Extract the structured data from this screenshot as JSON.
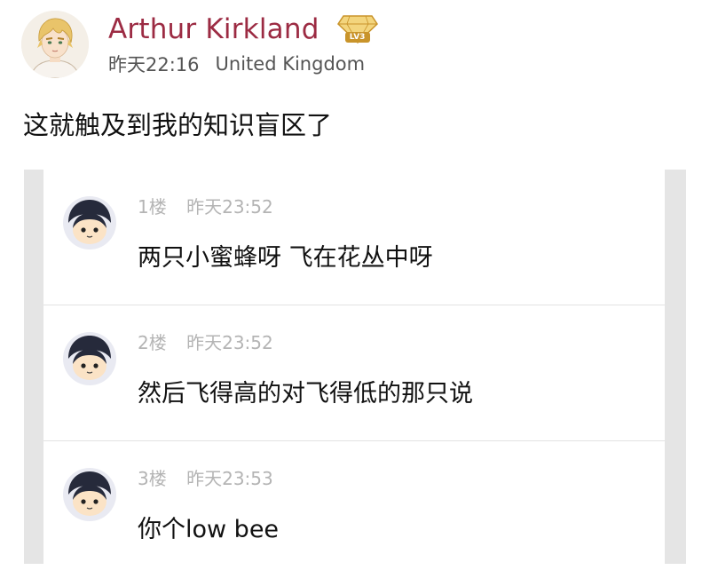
{
  "post": {
    "author_name": "Arthur Kirkland",
    "level_badge": "LV3",
    "time": "昨天22:16",
    "location": "United Kingdom",
    "text": "这就触及到我的知识盲区了",
    "avatar_icon": "blond-anime-character-avatar",
    "badge_icon": "gold-diamond-level-badge-icon",
    "name_color": "#9c2b43"
  },
  "comments": [
    {
      "floor": "1楼",
      "time": "昨天23:52",
      "text": "两只小蜜蜂呀 飞在花丛中呀",
      "avatar_icon": "cartoon-black-hair-avatar"
    },
    {
      "floor": "2楼",
      "time": "昨天23:52",
      "text": "然后飞得高的对飞得低的那只说",
      "avatar_icon": "cartoon-black-hair-avatar"
    },
    {
      "floor": "3楼",
      "time": "昨天23:53",
      "text": "你个low bee",
      "avatar_icon": "cartoon-black-hair-avatar"
    }
  ]
}
